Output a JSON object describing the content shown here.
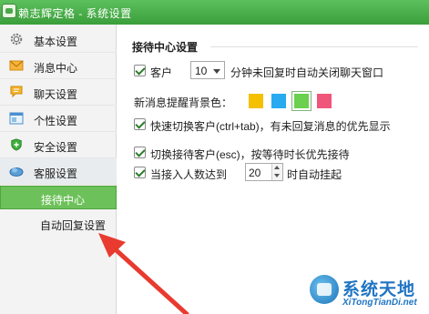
{
  "window": {
    "title": "赖志辉定格 - 系统设置"
  },
  "sidebar": {
    "items": [
      {
        "label": "基本设置",
        "icon": "gear-icon"
      },
      {
        "label": "消息中心",
        "icon": "envelope-icon"
      },
      {
        "label": "聊天设置",
        "icon": "chat-bubble-icon"
      },
      {
        "label": "个性设置",
        "icon": "window-icon"
      },
      {
        "label": "安全设置",
        "icon": "shield-icon"
      },
      {
        "label": "客服设置",
        "icon": "cloud-icon"
      }
    ],
    "sub_items": [
      {
        "label": "接待中心",
        "active": true
      },
      {
        "label": "自动回复设置",
        "active": false
      }
    ]
  },
  "content": {
    "section_title": "接待中心设置",
    "auto_close": {
      "checked": true,
      "prefix": "客户",
      "value": "10",
      "suffix": "分钟未回复时自动关闭聊天窗口"
    },
    "bg_color": {
      "label": "新消息提醒背景色：",
      "swatches": [
        "#f5c000",
        "#29aaf0",
        "#6ad04e",
        "#f0567a"
      ],
      "selected_index": 2
    },
    "quick_switch": {
      "checked": true,
      "label": "快速切换客户(ctrl+tab)，有未回复消息的优先显示"
    },
    "switch_wait": {
      "checked": true,
      "label": "切换接待客户(esc)，按等待时长优先接待"
    },
    "auto_hangup": {
      "checked": true,
      "prefix": "当接入人数达到",
      "value": "20",
      "suffix": "时自动挂起"
    }
  },
  "annotation": {
    "arrow_color": "#e83a2f"
  },
  "watermark": {
    "name": "系统天地",
    "url": "XiTongTianDi.net",
    "color": "#1f74c4"
  }
}
